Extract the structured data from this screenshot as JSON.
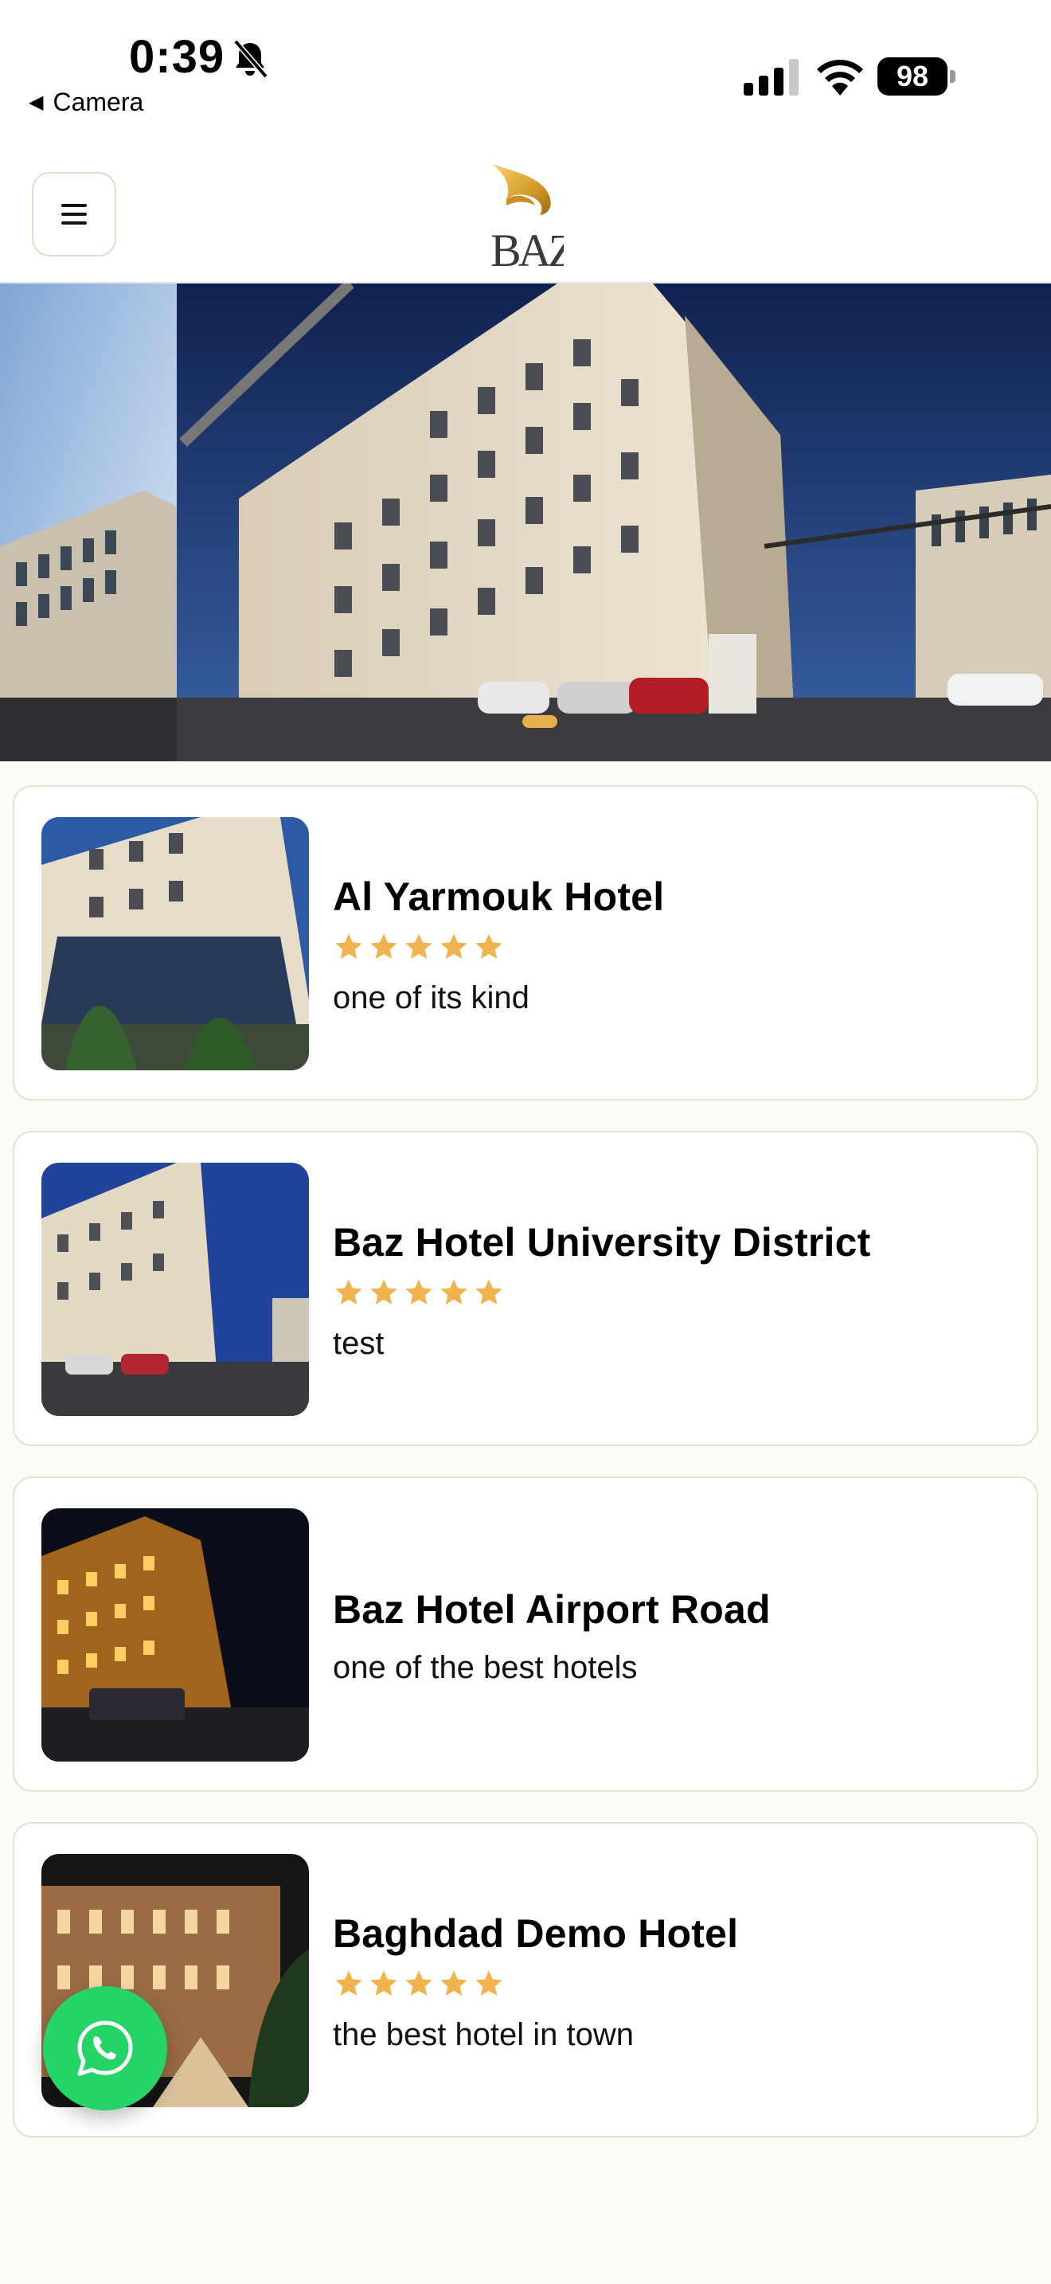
{
  "status_bar": {
    "time": "0:39",
    "back_app": "Camera",
    "battery_level": "98",
    "icons": [
      "bell-slash-icon",
      "cellular-signal-icon",
      "wifi-icon",
      "battery-icon"
    ]
  },
  "header": {
    "menu_icon": "hamburger-menu-icon",
    "logo_text": "BAZ"
  },
  "hero": {
    "slides_visible": 2,
    "active_indicator": 1
  },
  "hotels": [
    {
      "name": "Al Yarmouk Hotel",
      "stars": 5,
      "description": "one of its kind"
    },
    {
      "name": "Baz Hotel University District",
      "stars": 5,
      "description": "test"
    },
    {
      "name": "Baz Hotel Airport Road",
      "stars": 0,
      "description": "one of the best hotels"
    },
    {
      "name": "Baghdad Demo Hotel",
      "stars": 5,
      "description": "the best hotel in town"
    }
  ],
  "floating_action": {
    "icon": "whatsapp-icon"
  },
  "colors": {
    "accent_gold": "#e8b04d",
    "star": "#f0b34e",
    "whatsapp": "#25d366",
    "card_border": "#e8e0cc",
    "background": "#fcfbf8"
  }
}
